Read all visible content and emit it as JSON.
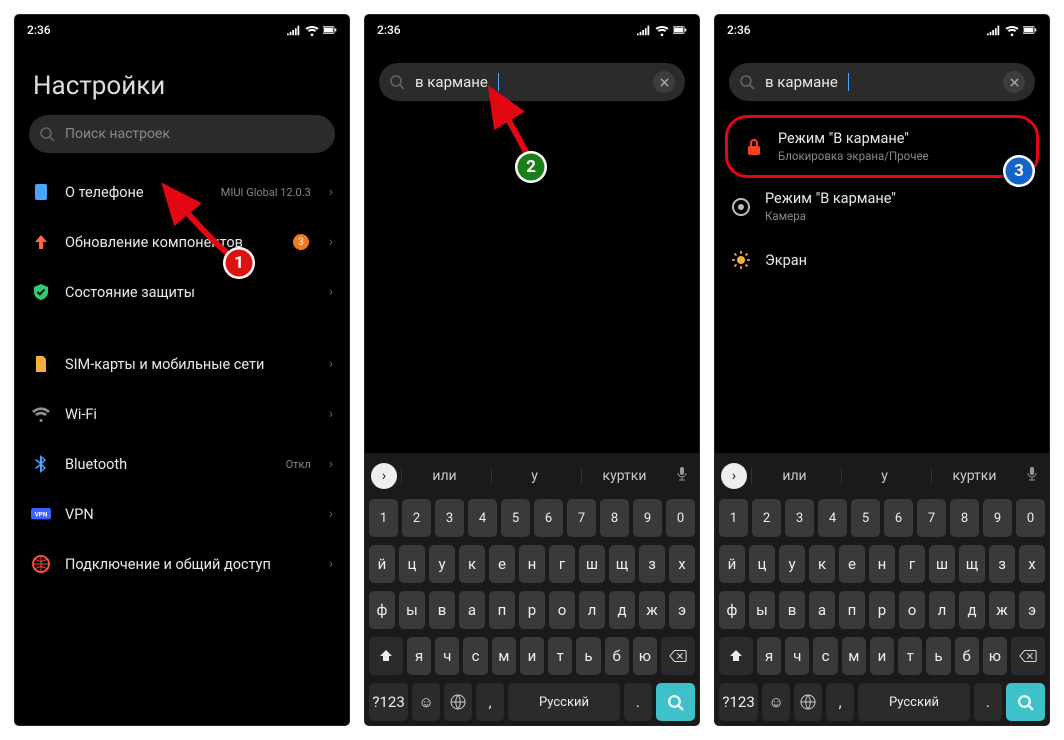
{
  "statusbar": {
    "time": "2:36"
  },
  "screen1": {
    "title": "Настройки",
    "search_placeholder": "Поиск настроек",
    "items": [
      {
        "icon": "phone-icon",
        "label": "О телефоне",
        "trail": "MIUI Global 12.0.3",
        "icon_color": "#4aa3ff",
        "chevron": true
      },
      {
        "icon": "arrow-up-icon",
        "label": "Обновление компонентов",
        "badge": "3",
        "icon_color": "#ff6a3d",
        "chevron": true
      },
      {
        "icon": "shield-icon",
        "label": "Состояние защиты",
        "icon_color": "#2ecc71",
        "chevron": true
      },
      {
        "gap": true
      },
      {
        "icon": "sim-icon",
        "label": "SIM-карты и мобильные сети",
        "icon_color": "#f5b041",
        "chevron": true
      },
      {
        "icon": "wifi-icon",
        "label": "Wi-Fi",
        "trail": "",
        "icon_color": "#8e8e8e",
        "chevron": true
      },
      {
        "icon": "bluetooth-icon",
        "label": "Bluetooth",
        "trail": "Откл",
        "icon_color": "#4aa3ff",
        "chevron": true
      },
      {
        "icon": "vpn-icon",
        "label": "VPN",
        "icon_color": "#3a63ff",
        "chevron": true
      },
      {
        "icon": "share-icon",
        "label": "Подключение и общий доступ",
        "icon_color": "#ff4d3a",
        "chevron": true
      }
    ],
    "annotation_number": "1"
  },
  "screen2": {
    "search_value": "в кармане",
    "annotation_number": "2"
  },
  "screen3": {
    "search_value": "в кармане",
    "results": [
      {
        "icon": "lock-icon",
        "label": "Режим \"В кармане\"",
        "sub": "Блокировка экрана/Прочее",
        "icon_color": "#ff4020",
        "highlight": true
      },
      {
        "icon": "radio-icon",
        "label": "Режим \"В кармане\"",
        "sub": "Камера",
        "icon_color": "#bbb"
      },
      {
        "icon": "sun-icon",
        "label": "Экран",
        "sub": "",
        "icon_color": "#f5b041"
      }
    ],
    "annotation_number": "3"
  },
  "keyboard": {
    "suggestions": [
      "или",
      "у",
      "куртки"
    ],
    "numbers": [
      "1",
      "2",
      "3",
      "4",
      "5",
      "6",
      "7",
      "8",
      "9",
      "0"
    ],
    "row1": [
      "й",
      "ц",
      "у",
      "к",
      "е",
      "н",
      "г",
      "ш",
      "щ",
      "з",
      "х"
    ],
    "row2": [
      "ф",
      "ы",
      "в",
      "а",
      "п",
      "р",
      "о",
      "л",
      "д",
      "ж",
      "э"
    ],
    "row3": [
      "я",
      "ч",
      "с",
      "м",
      "и",
      "т",
      "ь",
      "б",
      "ю"
    ],
    "sym": "?123",
    "comma": ",",
    "lang": "Русский",
    "dot": "."
  }
}
